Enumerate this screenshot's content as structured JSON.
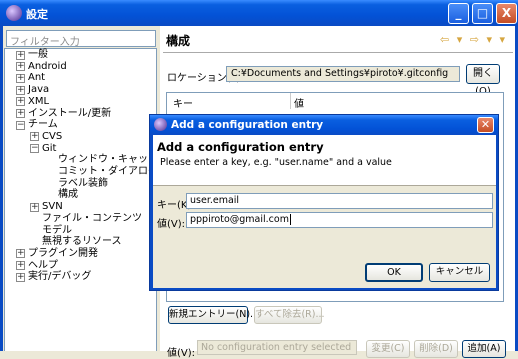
{
  "window": {
    "title": "設定",
    "btn_min": "_",
    "btn_max": "□",
    "btn_close": "X"
  },
  "left": {
    "filter_placeholder": "フィルター入力",
    "tree": [
      {
        "label": "一般",
        "expander": "+"
      },
      {
        "label": "Android",
        "expander": "+"
      },
      {
        "label": "Ant",
        "expander": "+"
      },
      {
        "label": "Java",
        "expander": "+"
      },
      {
        "label": "XML",
        "expander": "+"
      },
      {
        "label": "インストール/更新",
        "expander": "+"
      },
      {
        "label": "チーム",
        "expander": "−"
      },
      {
        "label": "CVS",
        "expander": "+"
      },
      {
        "label": "Git",
        "expander": "−"
      },
      {
        "label": "ウィンドウ・キャッシュ",
        "expander": ""
      },
      {
        "label": "コミット・ダイアログ",
        "expander": ""
      },
      {
        "label": "ラベル装飾",
        "expander": ""
      },
      {
        "label": "構成",
        "expander": ""
      },
      {
        "label": "SVN",
        "expander": "+"
      },
      {
        "label": "ファイル・コンテンツ",
        "expander": ""
      },
      {
        "label": "モデル",
        "expander": ""
      },
      {
        "label": "無視するリソース",
        "expander": ""
      },
      {
        "label": "プラグイン開発",
        "expander": "+"
      },
      {
        "label": "ヘルプ",
        "expander": "+"
      },
      {
        "label": "実行/デバッグ",
        "expander": "+"
      }
    ]
  },
  "right": {
    "title": "構成",
    "nav": "⇦ ▾ ⇨ ▾ ▾",
    "location_label": "ロケーション(L):",
    "location_value": "C:¥Documents and Settings¥piroto¥.gitconfig",
    "open_button": "開く(O)",
    "col_key": "キー",
    "col_value": "値",
    "new_entry_button": "新規エントリー(N)...",
    "remove_all_button": "すべて除去(R)...",
    "value_label": "値(V):",
    "value_placeholder": "No configuration entry selected",
    "change_button": "変更(C)",
    "delete_button": "削除(D)",
    "add_button": "追加(A)"
  },
  "dialog": {
    "title": "Add a configuration entry",
    "heading": "Add a configuration entry",
    "message": "Please enter a key, e.g. \"user.name\" and a value",
    "key_label": "キー(K):",
    "key_value": "user.email",
    "value_label": "値(V):",
    "value_value": "pppiroto@gmail.com",
    "ok_button": "OK",
    "cancel_button": "キャンセル",
    "close_glyph": "✕"
  }
}
